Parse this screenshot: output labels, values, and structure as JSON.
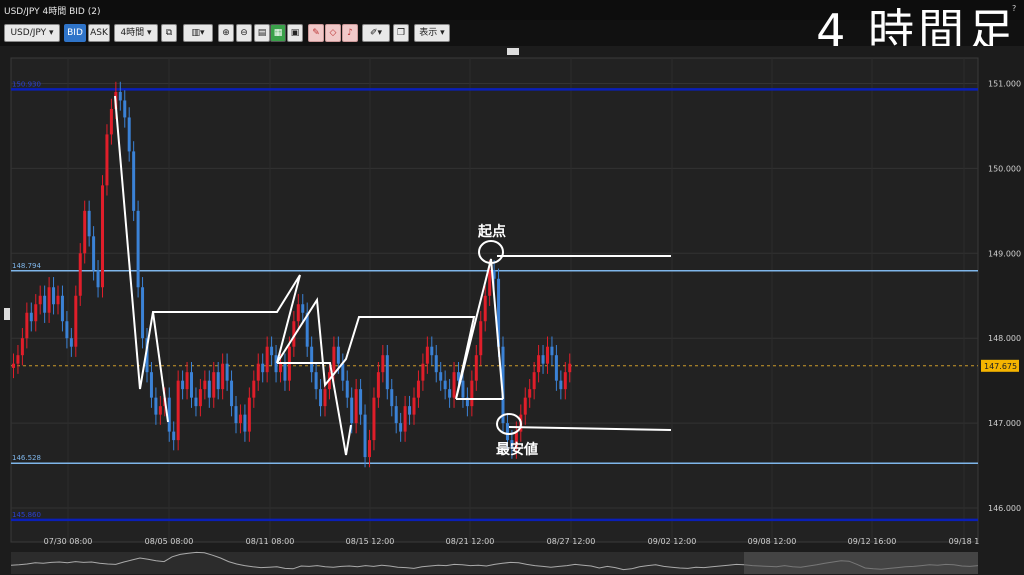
{
  "window": {
    "title": "USD/JPY 4時間 BID (2)",
    "help": "?",
    "overlay_title": "4 時間足"
  },
  "toolbar": {
    "pair": "USD/JPY",
    "bid_label": "BID",
    "ask_label": "ASK",
    "timeframe": "4時間",
    "display_label": "表示"
  },
  "colors": {
    "background": "#222222",
    "up_candle": "#e01e2a",
    "down_candle": "#3b82d6",
    "line_blue": "#7fb6ea",
    "line_navy": "#0a1fb8",
    "price_tag": "#f5b400",
    "annotation": "#ffffff"
  },
  "chart_data": {
    "type": "candlestick",
    "symbol": "USD/JPY",
    "timeframe": "4h",
    "ylim": [
      145.6,
      151.3
    ],
    "y_ticks": [
      "151.000",
      "150.000",
      "149.000",
      "148.000",
      "147.000",
      "146.000"
    ],
    "x_ticks": [
      "07/30 08:00",
      "08/05 08:00",
      "08/11 08:00",
      "08/15 12:00",
      "08/21 12:00",
      "08/27 12:00",
      "09/02 12:00",
      "09/08 12:00",
      "09/12 16:00",
      "09/18 1"
    ],
    "current_price": "147.675",
    "horizontal_lines": [
      {
        "value": 150.93,
        "label": "150.930",
        "color": "navy"
      },
      {
        "value": 148.794,
        "label": "148.794",
        "color": "blue"
      },
      {
        "value": 146.528,
        "label": "146.528",
        "color": "blue"
      },
      {
        "value": 145.86,
        "label": "145.860",
        "color": "navy"
      }
    ],
    "closes": [
      147.7,
      147.8,
      148.0,
      148.3,
      148.2,
      148.4,
      148.5,
      148.3,
      148.6,
      148.4,
      148.5,
      148.2,
      148.0,
      147.9,
      148.5,
      149.0,
      149.5,
      149.2,
      148.8,
      148.6,
      149.8,
      150.4,
      150.7,
      150.9,
      150.8,
      150.6,
      150.2,
      149.5,
      148.6,
      148.0,
      147.6,
      147.3,
      147.1,
      147.2,
      147.3,
      146.9,
      146.8,
      147.5,
      147.4,
      147.6,
      147.3,
      147.2,
      147.4,
      147.5,
      147.3,
      147.6,
      147.4,
      147.7,
      147.5,
      147.2,
      147.0,
      147.1,
      146.9,
      147.3,
      147.5,
      147.7,
      147.6,
      147.9,
      147.8,
      147.6,
      147.7,
      147.5,
      147.9,
      148.2,
      148.4,
      148.3,
      147.9,
      147.6,
      147.4,
      147.2,
      147.4,
      147.6,
      147.9,
      147.7,
      147.5,
      147.3,
      147.0,
      147.4,
      147.1,
      146.6,
      146.8,
      147.3,
      147.6,
      147.8,
      147.4,
      147.2,
      147.0,
      146.9,
      147.2,
      147.1,
      147.3,
      147.5,
      147.7,
      147.9,
      147.8,
      147.6,
      147.5,
      147.4,
      147.3,
      147.6,
      147.5,
      147.3,
      147.2,
      147.5,
      147.8,
      148.2,
      148.5,
      148.8,
      148.7,
      147.9,
      147.0,
      146.8,
      146.7,
      146.9,
      147.1,
      147.3,
      147.4,
      147.6,
      147.8,
      147.7,
      147.9,
      147.8,
      147.5,
      147.4,
      147.6,
      147.7
    ]
  },
  "annotations": {
    "start_label": "起点",
    "low_label": "最安値"
  }
}
